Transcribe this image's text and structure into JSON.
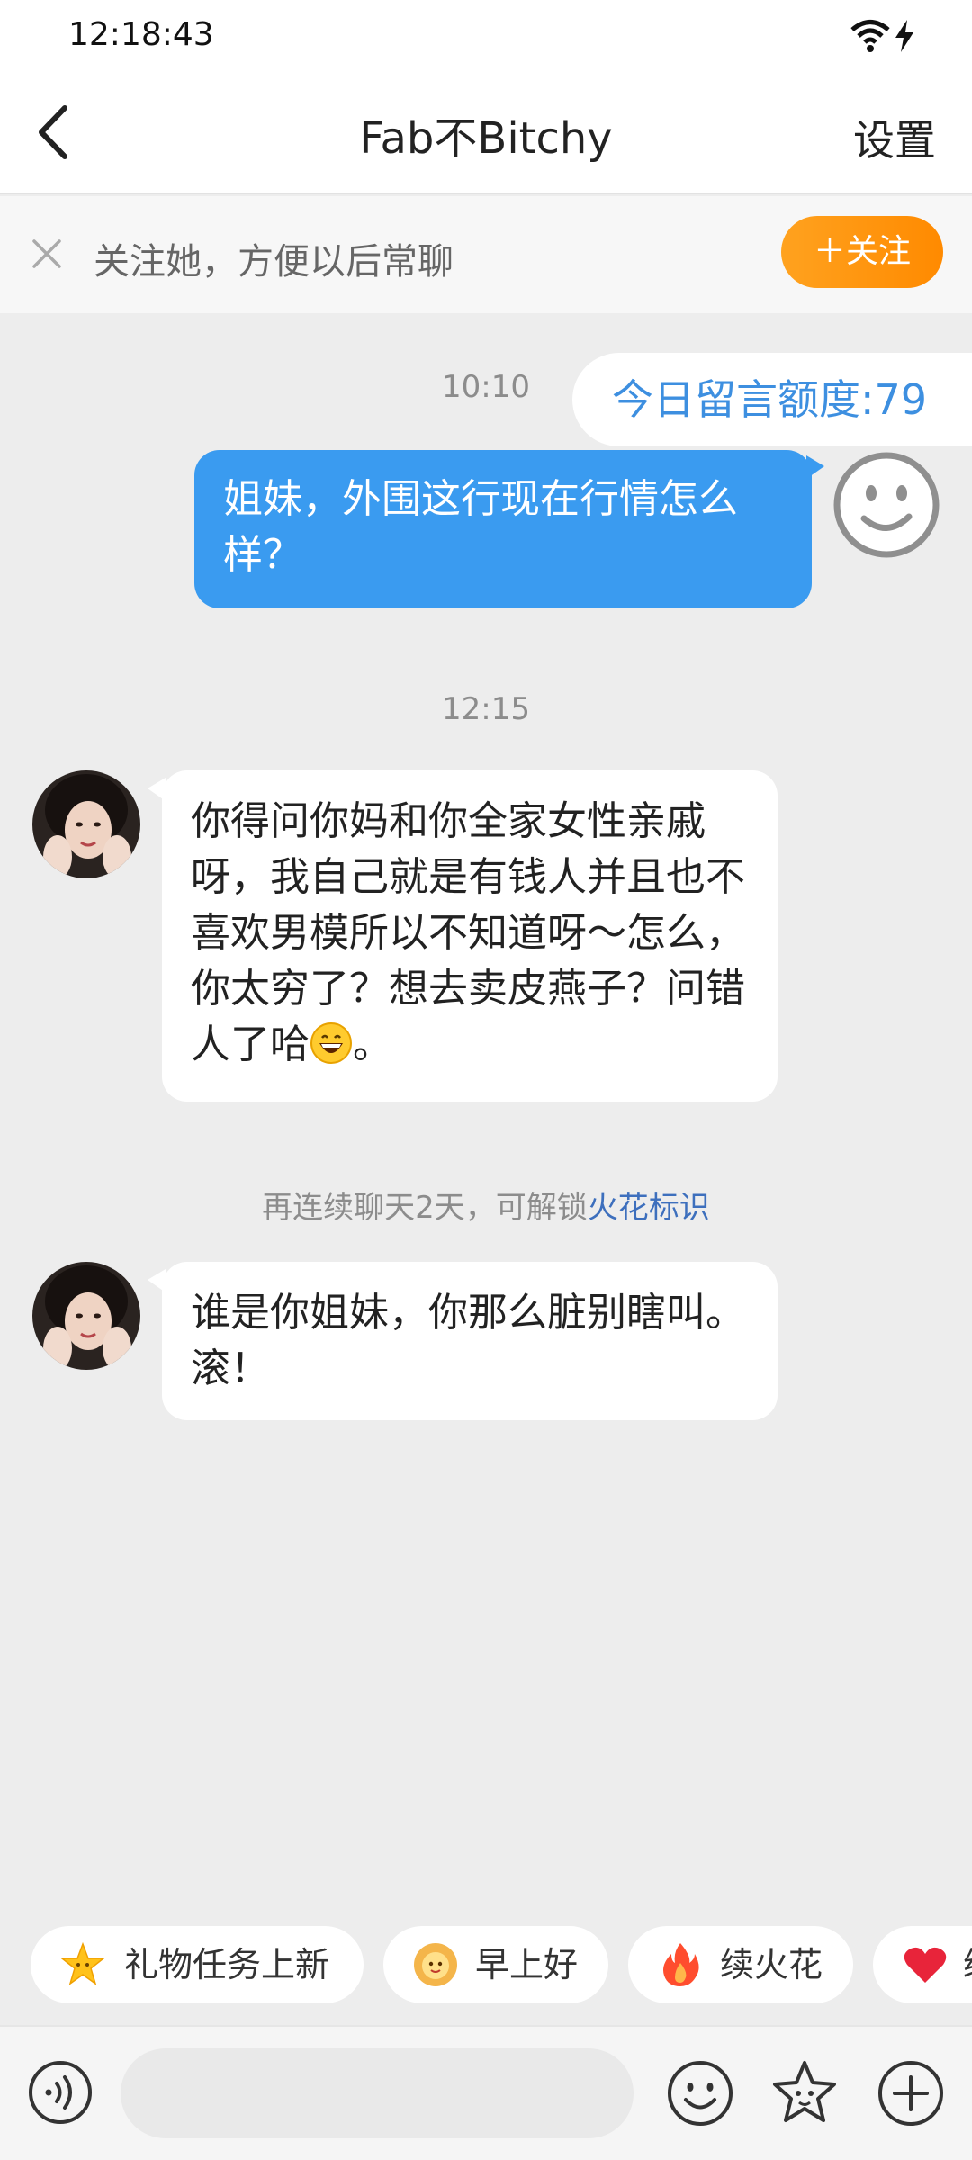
{
  "status_bar": {
    "time": "12:18:43"
  },
  "header": {
    "title": "Fab不Bitchy",
    "settings_label": "设置"
  },
  "follow_banner": {
    "text": "关注她，方便以后常聊",
    "button_label": "＋关注"
  },
  "quota_badge": {
    "text": "今日留言额度:79"
  },
  "messages": [
    {
      "time": "10:10",
      "direction": "outgoing",
      "text": "姐妹，外围这行现在行情怎么样？"
    },
    {
      "time": "12:15",
      "direction": "incoming",
      "text": "你得问你妈和你全家女性亲戚呀，我自己就是有钱人并且也不喜欢男模所以不知道呀～怎么，你太穷了？想去卖皮燕子？问错人了哈",
      "emoji": "grinning-face-emoji",
      "text_tail": "。"
    },
    {
      "direction": "incoming",
      "text": "谁是你姐妹，你那么脏别瞎叫。滚！"
    }
  ],
  "spark_notice": {
    "prefix": "再连续聊天2天，可解锁",
    "link": "火花标识"
  },
  "quick_chips": [
    {
      "label": "礼物任务上新",
      "icon": "star-icon"
    },
    {
      "label": "早上好",
      "icon": "sun-face-icon"
    },
    {
      "label": "续火花",
      "icon": "fire-icon"
    },
    {
      "label": "续",
      "icon": "heart-icon"
    }
  ],
  "colors": {
    "accent_blue": "#3a9bf0",
    "follow_orange": "#ff8a00",
    "link_blue": "#3d6fbd"
  }
}
